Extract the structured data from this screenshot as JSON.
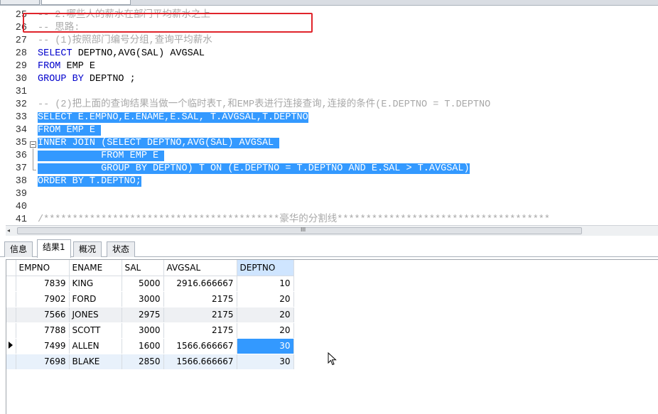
{
  "editor": {
    "lines": [
      {
        "n": "25",
        "segments": [
          {
            "cls": "cmt",
            "t": "-- 2.哪些人的薪水在部门平均薪水之上"
          }
        ]
      },
      {
        "n": "26",
        "segments": [
          {
            "cls": "cmt",
            "t": "-- 思路:"
          }
        ]
      },
      {
        "n": "27",
        "segments": [
          {
            "cls": "cmt",
            "t": "-- (1)按照部门编号分组,查询平均薪水"
          }
        ]
      },
      {
        "n": "28",
        "segments": [
          {
            "cls": "kw",
            "t": "SELECT"
          },
          {
            "cls": "plain",
            "t": " DEPTNO,AVG(SAL) AVGSAL"
          }
        ]
      },
      {
        "n": "29",
        "segments": [
          {
            "cls": "kw",
            "t": "FROM"
          },
          {
            "cls": "plain",
            "t": " EMP E"
          }
        ]
      },
      {
        "n": "30",
        "segments": [
          {
            "cls": "kw",
            "t": "GROUP BY"
          },
          {
            "cls": "plain",
            "t": " DEPTNO ;"
          }
        ]
      },
      {
        "n": "31",
        "segments": []
      },
      {
        "n": "32",
        "segments": [
          {
            "cls": "cmt",
            "t": "-- (2)把上面的查询结果当做一个临时表T,和EMP表进行连接查询,连接的条件(E.DEPTNO = T.DEPTNO"
          }
        ]
      },
      {
        "n": "33",
        "segments": [
          {
            "cls": "sel",
            "t": "SELECT E.EMPNO,E.ENAME,E.SAL, T.AVGSAL,T.DEPTNO"
          }
        ]
      },
      {
        "n": "34",
        "segments": [
          {
            "cls": "sel",
            "t": "FROM EMP E "
          }
        ]
      },
      {
        "n": "35",
        "segments": [
          {
            "cls": "sel",
            "t": "INNER JOIN (SELECT DEPTNO,AVG(SAL) AVGSAL "
          }
        ]
      },
      {
        "n": "36",
        "segments": [
          {
            "cls": "sel",
            "t": "           FROM EMP E "
          }
        ]
      },
      {
        "n": "37",
        "segments": [
          {
            "cls": "sel",
            "t": "           GROUP BY DEPTNO) T ON (E.DEPTNO = T.DEPTNO AND E.SAL > T.AVGSAL)"
          }
        ]
      },
      {
        "n": "38",
        "segments": [
          {
            "cls": "sel",
            "t": "ORDER BY T.DEPTNO;"
          }
        ]
      },
      {
        "n": "39",
        "segments": []
      },
      {
        "n": "40",
        "segments": []
      },
      {
        "n": "41",
        "segments": [
          {
            "cls": "cmt",
            "t": "/*****************************************豪华的分割线*************************************"
          }
        ]
      }
    ]
  },
  "hscroll": {
    "left_arrow": "◂",
    "grip": "III"
  },
  "result_tabs": [
    "信息",
    "结果1",
    "概况",
    "状态"
  ],
  "grid": {
    "columns": [
      "EMPNO",
      "ENAME",
      "SAL",
      "AVGSAL",
      "DEPTNO"
    ],
    "rows": [
      [
        "7839",
        "KING",
        "5000",
        "2916.666667",
        "10"
      ],
      [
        "7902",
        "FORD",
        "3000",
        "2175",
        "20"
      ],
      [
        "7566",
        "JONES",
        "2975",
        "2175",
        "20"
      ],
      [
        "7788",
        "SCOTT",
        "3000",
        "2175",
        "20"
      ],
      [
        "7499",
        "ALLEN",
        "1600",
        "1566.666667",
        "30"
      ],
      [
        "7698",
        "BLAKE",
        "2850",
        "1566.666667",
        "30"
      ]
    ]
  },
  "colors": {
    "selection": "#3399ff",
    "keyword": "#0000cc",
    "comment": "#a8a8a8",
    "highlight_box": "#e0242b"
  }
}
